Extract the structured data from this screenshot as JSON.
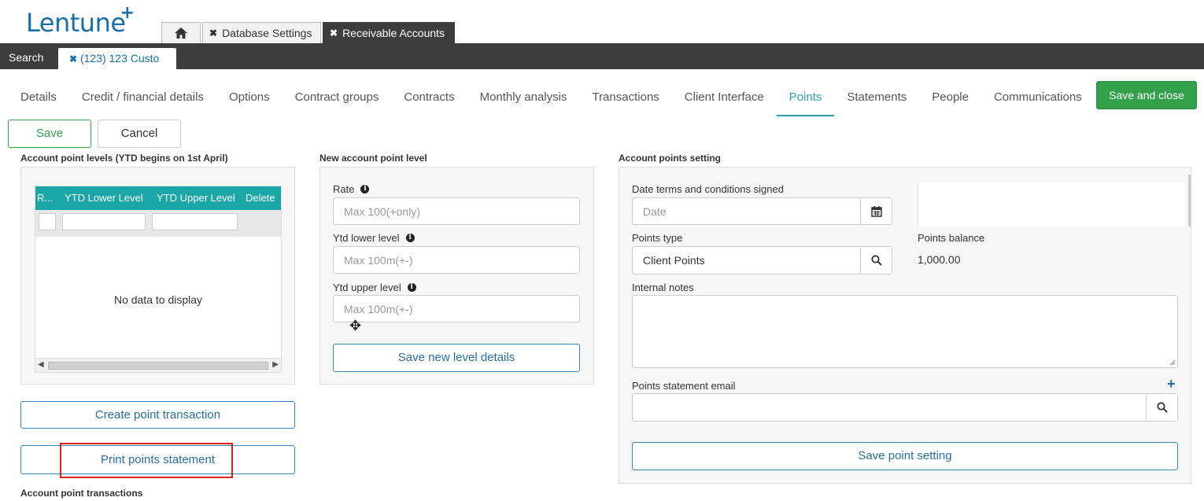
{
  "app": {
    "logo": "Lentune"
  },
  "top_tabs": [
    {
      "label": ""
    },
    {
      "label": "Database Settings"
    },
    {
      "label": "Receivable Accounts"
    }
  ],
  "subbar": {
    "search_label": "Search",
    "customer_tab": "(123) 123 Custo"
  },
  "nav_tabs": [
    "Details",
    "Credit / financial details",
    "Options",
    "Contract groups",
    "Contracts",
    "Monthly analysis",
    "Transactions",
    "Client Interface",
    "Points",
    "Statements",
    "People",
    "Communications"
  ],
  "active_tab": "Points",
  "actions": {
    "save_close": "Save and close",
    "save": "Save",
    "cancel": "Cancel"
  },
  "levels": {
    "title": "Account point levels (YTD begins on 1st April)",
    "columns": [
      "R...",
      "YTD Lower Level",
      "YTD Upper Level",
      "Delete"
    ],
    "empty_text": "No data to display",
    "create_btn": "Create point transaction",
    "print_btn": "Print points statement",
    "transactions_title": "Account point transactions"
  },
  "new_level": {
    "title": "New account point level",
    "rate_label": "Rate",
    "rate_placeholder": "Max 100(+only)",
    "lower_label": "Ytd lower level",
    "lower_placeholder": "Max 100m(+-)",
    "upper_label": "Ytd upper level",
    "upper_placeholder": "Max 100m(+-)",
    "save_btn": "Save new level details"
  },
  "settings": {
    "title": "Account points setting",
    "date_label": "Date terms and conditions signed",
    "date_placeholder": "Date",
    "points_type_label": "Points type",
    "points_type_value": "Client Points",
    "balance_label": "Points balance",
    "balance_value": "1,000.00",
    "notes_label": "Internal notes",
    "email_label": "Points statement email",
    "save_btn": "Save point setting"
  },
  "colors": {
    "accent": "#1ba7a7",
    "green": "#33a04a",
    "dark_bar": "#3d3d3d",
    "link_blue": "#1a6fa8"
  }
}
